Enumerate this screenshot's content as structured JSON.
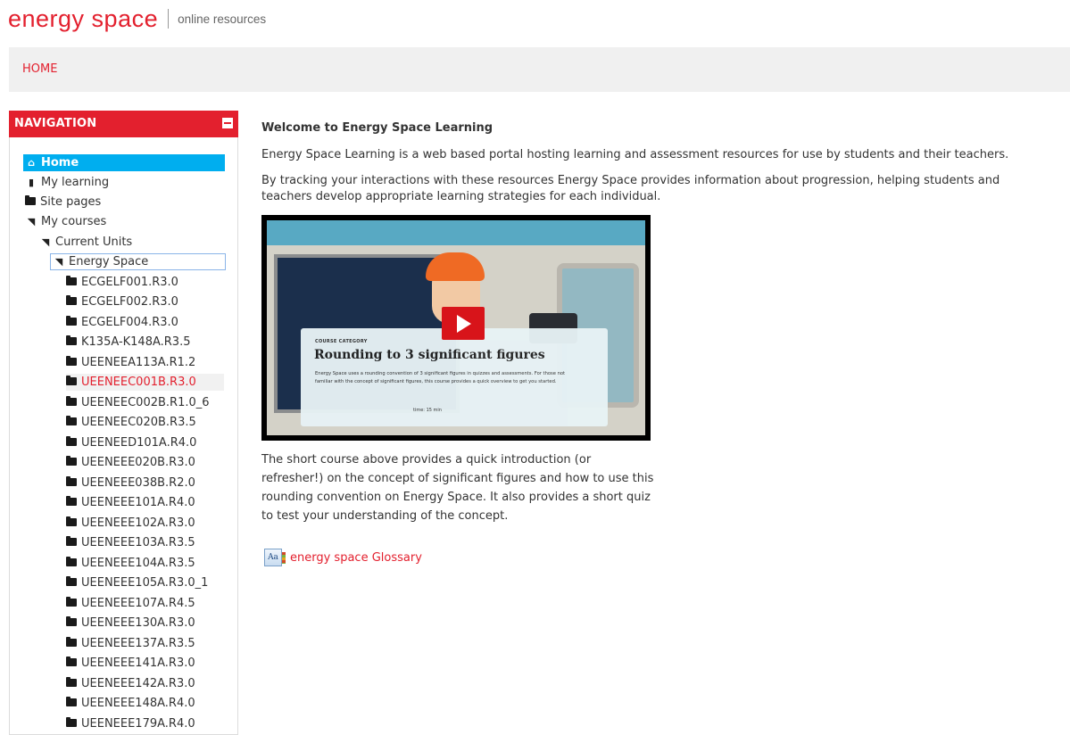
{
  "header": {
    "brand": "energy space",
    "tagline": "online resources"
  },
  "navbar": {
    "home": "HOME"
  },
  "navigation": {
    "title": "NAVIGATION",
    "home": "Home",
    "my_learning": "My learning",
    "site_pages": "Site pages",
    "my_courses": "My courses",
    "current_units": "Current Units",
    "energy_space": "Energy Space",
    "courses": [
      "ECGELF001.R3.0",
      "ECGELF002.R3.0",
      "ECGELF004.R3.0",
      "K135A-K148A.R3.5",
      "UEENEEA113A.R1.2",
      "UEENEEC001B.R3.0",
      "UEENEEC002B.R1.0_6",
      "UEENEEC020B.R3.5",
      "UEENEED101A.R4.0",
      "UEENEEE020B.R3.0",
      "UEENEEE038B.R2.0",
      "UEENEEE101A.R4.0",
      "UEENEEE102A.R3.0",
      "UEENEEE103A.R3.5",
      "UEENEEE104A.R3.5",
      "UEENEEE105A.R3.0_1",
      "UEENEEE107A.R4.5",
      "UEENEEE130A.R3.0",
      "UEENEEE137A.R3.5",
      "UEENEEE141A.R3.0",
      "UEENEEE142A.R3.0",
      "UEENEEE148A.R4.0",
      "UEENEEE179A.R4.0"
    ]
  },
  "main": {
    "welcome": "Welcome to Energy Space Learning",
    "intro": "Energy Space Learning is a web based portal hosting learning and assessment resources for use by students and their teachers.",
    "tracking": "By tracking your interactions with these resources Energy Space provides information about progression, helping students and teachers develop appropriate learning strategies for each individual.",
    "video": {
      "category": "COURSE CATEGORY",
      "title": "Rounding to 3 significant figures",
      "description": "Energy Space uses a rounding convention of 3 significant figures in quizzes and assessments. For those not familiar with the concept of significant figures, this course provides a quick overview to get you started.",
      "time": "time: 15 min"
    },
    "short_course": "The short course above provides a quick introduction (or refresher!) on the concept of significant figures and how to use this rounding convention on Energy Space. It also provides a short quiz to test your understanding of the concept.",
    "glossary_link": "energy space Glossary",
    "glossary_icon_text": "Aa"
  },
  "colors": {
    "brand": "#e3202e",
    "highlight": "#00aeef",
    "navbar_bg": "#f0f0f0"
  },
  "icons": {
    "home": "home-icon",
    "file": "file-icon",
    "folder": "folder-icon",
    "folder_open": "folder-open-icon",
    "collapse": "collapse-icon",
    "play": "play-icon",
    "glossary": "glossary-icon"
  }
}
